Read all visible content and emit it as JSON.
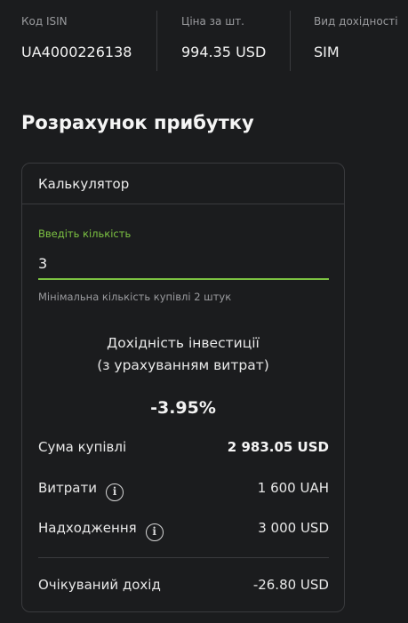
{
  "info": {
    "isin_label": "Код ISIN",
    "isin_value": "UA4000226138",
    "price_label": "Ціна за шт.",
    "price_value": "994.35 USD",
    "yield_type_label": "Вид дохідності",
    "yield_type_value": "SIM"
  },
  "section_title": "Розрахунок прибутку",
  "calculator": {
    "header": "Калькулятор",
    "quantity_label": "Введіть кількість",
    "quantity_value": "3",
    "hint": "Мінімальна кількість купівлі 2 штук",
    "yield_title_line1": "Дохідність інвестиції",
    "yield_title_line2": "(з урахуванням витрат)",
    "yield_value": "-3.95%",
    "rows": [
      {
        "label": "Сума купівлі",
        "value": "2 983.05 USD"
      },
      {
        "label": "Витрати",
        "value": "1 600 UAH"
      },
      {
        "label": "Надходження",
        "value": "3 000 USD"
      },
      {
        "label": "Очікуваний дохід",
        "value": "-26.80 USD"
      }
    ]
  },
  "colors": {
    "accent": "#7cc242",
    "background": "#1b1c1e",
    "border": "#3a3b3e"
  },
  "icons": {
    "info": "info-icon"
  }
}
